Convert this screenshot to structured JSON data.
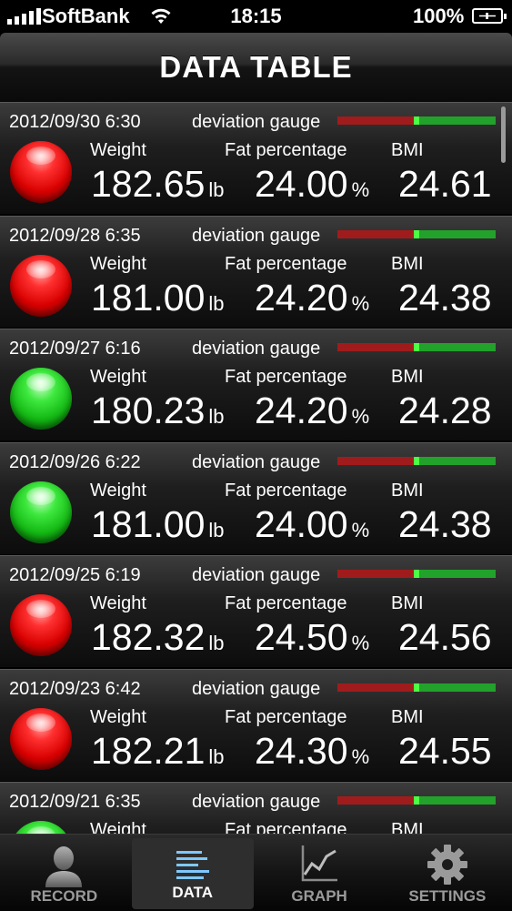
{
  "status": {
    "carrier": "SoftBank",
    "time": "18:15",
    "battery": "100%"
  },
  "navbar": {
    "title": "DATA TABLE"
  },
  "labels": {
    "gauge": "deviation gauge",
    "weight": "Weight",
    "fat": "Fat percentage",
    "bmi": "BMI",
    "weight_unit": "lb",
    "fat_unit": "%"
  },
  "colors": {
    "gauge_red": "#a01c1c",
    "gauge_green": "#22a22a",
    "gauge_marker": "#4cff44",
    "status_red": "#d80000",
    "status_green": "#14b814"
  },
  "records": [
    {
      "date": "2012/09/30 6:30",
      "weight": "182.65",
      "fat": "24.00",
      "bmi": "24.61",
      "status": "red",
      "gauge": 0.5
    },
    {
      "date": "2012/09/28 6:35",
      "weight": "181.00",
      "fat": "24.20",
      "bmi": "24.38",
      "status": "red",
      "gauge": 0.5
    },
    {
      "date": "2012/09/27 6:16",
      "weight": "180.23",
      "fat": "24.20",
      "bmi": "24.28",
      "status": "green",
      "gauge": 0.5
    },
    {
      "date": "2012/09/26 6:22",
      "weight": "181.00",
      "fat": "24.00",
      "bmi": "24.38",
      "status": "green",
      "gauge": 0.5
    },
    {
      "date": "2012/09/25 6:19",
      "weight": "182.32",
      "fat": "24.50",
      "bmi": "24.56",
      "status": "red",
      "gauge": 0.5
    },
    {
      "date": "2012/09/23 6:42",
      "weight": "182.21",
      "fat": "24.30",
      "bmi": "24.55",
      "status": "red",
      "gauge": 0.5
    },
    {
      "date": "2012/09/21 6:35",
      "weight": "",
      "fat": "",
      "bmi": "",
      "status": "green",
      "gauge": 0.5
    }
  ],
  "tabs": [
    {
      "label": "RECORD",
      "icon": "person-icon"
    },
    {
      "label": "DATA",
      "icon": "list-icon"
    },
    {
      "label": "GRAPH",
      "icon": "line-graph-icon"
    },
    {
      "label": "SETTINGS",
      "icon": "gear-icon"
    }
  ]
}
